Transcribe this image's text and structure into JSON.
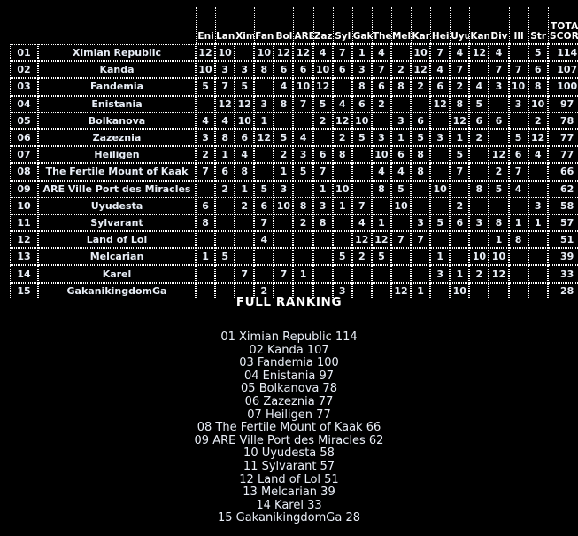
{
  "table": {
    "column_headers": [
      "Eni",
      "Lan",
      "Xim",
      "Fan",
      "Bol",
      "ARE",
      "Zaz",
      "Syl",
      "Gak",
      "The",
      "Mel",
      "Kar",
      "Hei",
      "Uyu",
      "Kan",
      "Div",
      "Ill",
      "Str"
    ],
    "total_header_line1": "TOTAL",
    "total_header_line2": "SCORE",
    "rows": [
      {
        "rank": "01",
        "name": "Ximian Republic",
        "scores": [
          "12",
          "10",
          "",
          "10",
          "12",
          "12",
          "4",
          "7",
          "1",
          "4",
          "",
          "10",
          "7",
          "4",
          "12",
          "4",
          "",
          "5"
        ],
        "total": "114"
      },
      {
        "rank": "02",
        "name": "Kanda",
        "scores": [
          "10",
          "3",
          "3",
          "8",
          "6",
          "6",
          "10",
          "6",
          "3",
          "7",
          "2",
          "12",
          "4",
          "7",
          "",
          "7",
          "7",
          "6"
        ],
        "total": "107"
      },
      {
        "rank": "03",
        "name": "Fandemia",
        "scores": [
          "5",
          "7",
          "5",
          "",
          "4",
          "10",
          "12",
          "",
          "8",
          "6",
          "8",
          "2",
          "6",
          "2",
          "4",
          "3",
          "10",
          "8"
        ],
        "total": "100"
      },
      {
        "rank": "04",
        "name": "Enistania",
        "scores": [
          "",
          "12",
          "12",
          "3",
          "8",
          "7",
          "5",
          "4",
          "6",
          "2",
          "",
          "",
          "12",
          "8",
          "5",
          "",
          "3",
          "10"
        ],
        "total": "97"
      },
      {
        "rank": "05",
        "name": "Bolkanova",
        "scores": [
          "4",
          "4",
          "10",
          "1",
          "",
          "",
          "2",
          "12",
          "10",
          "",
          "3",
          "6",
          "",
          "12",
          "6",
          "6",
          "",
          "2"
        ],
        "total": "78"
      },
      {
        "rank": "06",
        "name": "Zazeznia",
        "scores": [
          "3",
          "8",
          "6",
          "12",
          "5",
          "4",
          "",
          "2",
          "5",
          "3",
          "1",
          "5",
          "3",
          "1",
          "2",
          "",
          "5",
          "12"
        ],
        "total": "77"
      },
      {
        "rank": "07",
        "name": "Heiligen",
        "scores": [
          "2",
          "1",
          "4",
          "",
          "2",
          "3",
          "6",
          "8",
          "",
          "10",
          "6",
          "8",
          "",
          "5",
          "",
          "12",
          "6",
          "4"
        ],
        "total": "77"
      },
      {
        "rank": "08",
        "name": "The Fertile Mount of Kaak",
        "scores": [
          "7",
          "6",
          "8",
          "",
          "1",
          "5",
          "7",
          "",
          "",
          "4",
          "4",
          "8",
          "",
          "7",
          "",
          "2",
          "7",
          ""
        ],
        "total": "66"
      },
      {
        "rank": "09",
        "name": "ARE Ville Port des Miracles",
        "scores": [
          "",
          "2",
          "1",
          "5",
          "3",
          "",
          "1",
          "10",
          "",
          "8",
          "5",
          "",
          "10",
          "",
          "8",
          "5",
          "4",
          ""
        ],
        "total": "62"
      },
      {
        "rank": "10",
        "name": "Uyudesta",
        "scores": [
          "6",
          "",
          "2",
          "6",
          "10",
          "8",
          "3",
          "1",
          "7",
          "",
          "10",
          "",
          "",
          "2",
          "",
          "",
          "",
          "3"
        ],
        "total": "58"
      },
      {
        "rank": "11",
        "name": "Sylvarant",
        "scores": [
          "8",
          "",
          "",
          "7",
          "",
          "2",
          "8",
          "",
          "4",
          "1",
          "",
          "3",
          "5",
          "6",
          "3",
          "8",
          "1",
          "1"
        ],
        "total": "57"
      },
      {
        "rank": "12",
        "name": "Land of Lol",
        "scores": [
          "",
          "",
          "",
          "4",
          "",
          "",
          "",
          "",
          "12",
          "12",
          "7",
          "7",
          "",
          "",
          "",
          "1",
          "8",
          ""
        ],
        "total": "51"
      },
      {
        "rank": "13",
        "name": "Melcarian",
        "scores": [
          "1",
          "5",
          "",
          "",
          "",
          "",
          "",
          "5",
          "2",
          "5",
          "",
          "",
          "1",
          "",
          "10",
          "10",
          "",
          ""
        ],
        "total": "39"
      },
      {
        "rank": "14",
        "name": "Karel",
        "scores": [
          "",
          "",
          "7",
          "",
          "7",
          "1",
          "",
          "",
          "",
          "",
          "",
          "",
          "3",
          "1",
          "2",
          "12",
          "",
          ""
        ],
        "total": "33"
      },
      {
        "rank": "15",
        "name": "GakanikingdomGa",
        "scores": [
          "",
          "",
          "",
          "2",
          "",
          "",
          "",
          "3",
          "",
          "",
          "12",
          "1",
          "",
          "10",
          "",
          "",
          "",
          ""
        ],
        "total": "28"
      }
    ]
  },
  "ranking": {
    "title": "FULL RANKING",
    "entries": [
      "01 Ximian Republic 114",
      "02 Kanda 107",
      "03 Fandemia 100",
      "04 Enistania 97",
      "05 Bolkanova 78",
      "06 Zazeznia 77",
      "07 Heiligen 77",
      "08 The Fertile Mount of Kaak 66",
      "09 ARE Ville Port des Miracles 62",
      "10 Uyudesta 58",
      "11 Sylvarant 57",
      "12 Land of Lol 51",
      "13 Melcarian 39",
      "14 Karel 33",
      "15 GakanikingdomGa 28"
    ]
  },
  "colors": {
    "background": "#000000",
    "text": "#e9eef7",
    "total_accent": "#f07f1a",
    "top_score_highlight": "#f9a14a",
    "second_score_highlight": "#9c4a10"
  }
}
